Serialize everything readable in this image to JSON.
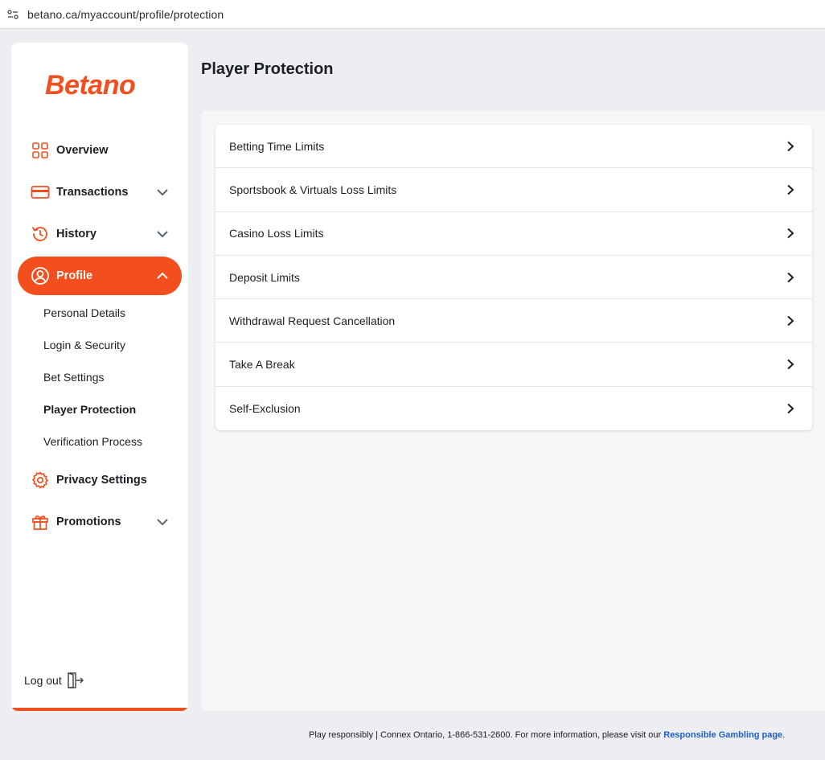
{
  "browser": {
    "url": "betano.ca/myaccount/profile/protection"
  },
  "brand": {
    "name": "Betano",
    "accent": "#f24e1e"
  },
  "sidebar": {
    "items": [
      {
        "label": "Overview",
        "icon": "grid-icon"
      },
      {
        "label": "Transactions",
        "icon": "card-icon"
      },
      {
        "label": "History",
        "icon": "history-icon"
      },
      {
        "label": "Profile",
        "icon": "user-icon"
      },
      {
        "label": "Privacy Settings",
        "icon": "gear-icon"
      },
      {
        "label": "Promotions",
        "icon": "gift-icon"
      }
    ],
    "profile_sub": [
      {
        "label": "Personal Details"
      },
      {
        "label": "Login & Security"
      },
      {
        "label": "Bet Settings"
      },
      {
        "label": "Player Protection"
      },
      {
        "label": "Verification Process"
      }
    ],
    "logout_label": "Log out"
  },
  "main": {
    "title": "Player Protection",
    "items": [
      {
        "label": "Betting Time Limits"
      },
      {
        "label": "Sportsbook & Virtuals Loss Limits"
      },
      {
        "label": "Casino Loss Limits"
      },
      {
        "label": "Deposit Limits"
      },
      {
        "label": "Withdrawal Request Cancellation"
      },
      {
        "label": "Take A Break"
      },
      {
        "label": "Self-Exclusion"
      }
    ]
  },
  "footer": {
    "text": "Play responsibly | Connex Ontario, 1-866-531-2600. For more information, please visit our ",
    "link": "Responsible Gambling page",
    "tail": "."
  }
}
